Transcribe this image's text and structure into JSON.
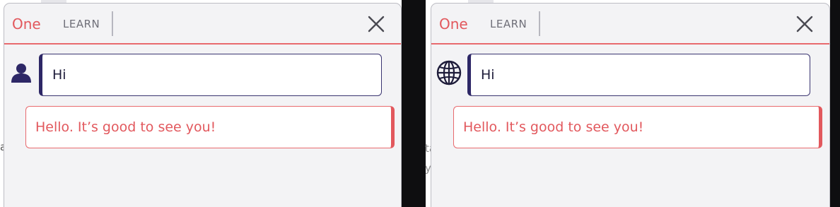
{
  "left_panel": {
    "brand": "One",
    "nav_learn": "LEARN",
    "user_message": "Hi",
    "assistant_reply": "Hello. It’s good to see you!",
    "avatar_icon": "user-icon"
  },
  "right_panel": {
    "brand": "One",
    "nav_learn": "LEARN",
    "user_message": "Hi",
    "assistant_reply": "Hello. It’s good to see you!",
    "avatar_icon": "globe-icon"
  },
  "background_fragments": {
    "left_a": "a",
    "right_ta": "ta",
    "right_y": "y"
  },
  "colors": {
    "accent": "#e2585d",
    "user_border": "#2d2766",
    "panel_bg": "#f3f3f5"
  }
}
